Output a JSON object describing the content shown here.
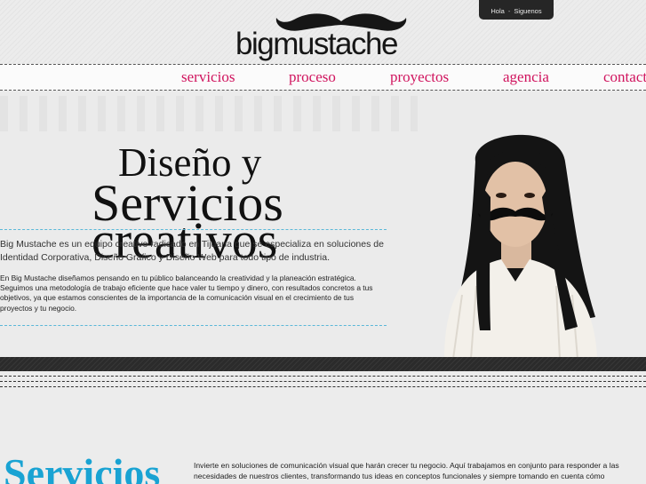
{
  "header": {
    "logo_text": "bigmustache",
    "topbar": {
      "hello": "Hola",
      "separator": "-",
      "follow": "Siguenos"
    }
  },
  "nav": {
    "items": [
      "servicios",
      "proceso",
      "proyectos",
      "agencia",
      "contacto"
    ]
  },
  "hero": {
    "title_line1": "Diseño y",
    "title_line2": "Servicios",
    "title_line3": "creativos",
    "paragraph1": "Big Mustache es un equipo creativo radicado en Tijuana que se especializa en soluciones de Identidad Corporativa, Diseño Gráfico y Diseño Web para todo tipo de industria.",
    "paragraph2": "En Big Mustache diseñamos pensando en tu público balanceando la creatividad y la planeación estratégica. Seguimos una metodología de trabajo eficiente que hace valer tu tiempo y dinero, con resultados concretos a tus objetivos, ya que estamos conscientes de la importancia de la comunicación visual en el crecimiento de tus proyectos y tu negocio."
  },
  "services": {
    "title": "Servicios",
    "text": "Invierte en soluciones de comunicación visual que harán crecer tu negocio. Aquí trabajamos en conjunto para responder a las necesidades de nuestros clientes, transformando tus ideas en conceptos funcionales y siempre tomando en cuenta cómo"
  },
  "colors": {
    "nav_link": "#d0145e",
    "accent_blue": "#19a3d3",
    "dark": "#2b2b2b"
  }
}
